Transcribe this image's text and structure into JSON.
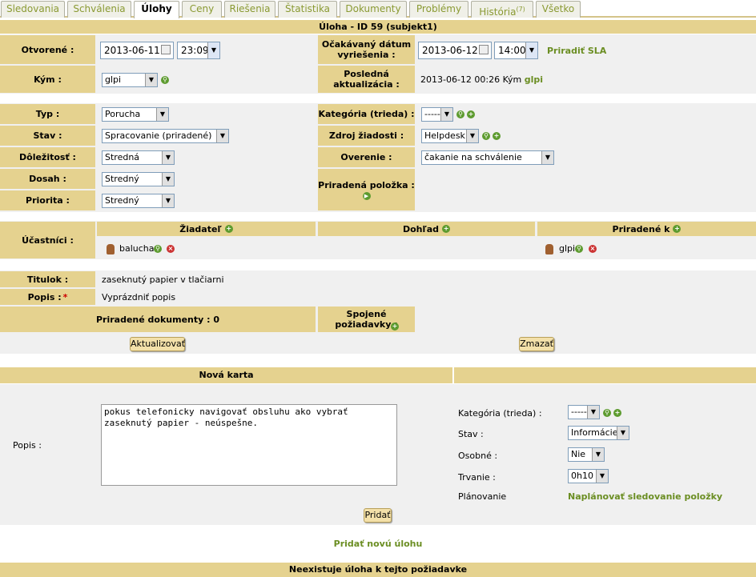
{
  "tabs": [
    "Sledovania",
    "Schválenia",
    "Úlohy",
    "Ceny",
    "Riešenia",
    "Štatistika",
    "Dokumenty",
    "Problémy",
    "História",
    "Všetko"
  ],
  "history_count": "(7)",
  "title": "Úloha - ID 59 (subjekt1)",
  "opened_label": "Otvorené :",
  "opened_date": "2013-06-11",
  "opened_time": "23:09",
  "expected_label": "Očakávaný dátum vyriešenia :",
  "expected_date": "2013-06-12",
  "expected_time": "14:00",
  "sla_link": "Priradiť SLA",
  "by_label": "Kým :",
  "by_value": "glpi",
  "last_update_label": "Posledná aktualizácia :",
  "last_update_text": "2013-06-12 00:26 Kým",
  "last_update_user": "glpi",
  "type_label": "Typ :",
  "type_value": "Porucha",
  "status_label": "Stav :",
  "status_value": "Spracovanie (priradené)",
  "urgency_label": "Dôležitosť :",
  "urgency_value": "Stredná",
  "impact_label": "Dosah :",
  "impact_value": "Stredný",
  "priority_label": "Priorita :",
  "priority_value": "Stredný",
  "category_label": "Kategória (trieda) :",
  "category_value": "-----",
  "source_label": "Zdroj žiadosti :",
  "source_value": "Helpdesk",
  "validation_label": "Overenie :",
  "validation_value": "čakanie na schválenie",
  "item_label": "Priradená položka :",
  "actors_label": "Účastníci :",
  "requester_header": "Žiadateľ",
  "observer_header": "Dohľad",
  "assigned_header": "Priradené k",
  "requester_name": "balucha",
  "assigned_name": "glpi",
  "title_label": "Titulok :",
  "title_value": "zaseknutý papier v tlačiarni",
  "desc_label": "Popis :",
  "desc_required": "*",
  "desc_value": "Vyprázdniť popis",
  "docs_label": "Priradené dokumenty : 0",
  "linked_label": "Spojené požiadavky :",
  "update_button": "Aktualizovať",
  "delete_button": "Zmazať",
  "new_card_header": "Nová karta",
  "nc_desc_label": "Popis :",
  "nc_desc_value": "pokus telefonicky navigovať obsluhu ako vybrať zaseknutý papier - neúspešne.",
  "nc_category_label": "Kategória (trieda) :",
  "nc_category_value": "-----",
  "nc_status_label": "Stav :",
  "nc_status_value": "Informácie",
  "nc_private_label": "Osobné :",
  "nc_private_value": "Nie",
  "nc_duration_label": "Trvanie :",
  "nc_duration_value": "0h10",
  "nc_planning_label": "Plánovanie",
  "nc_planning_link": "Naplánovať sledovanie položky",
  "add_button": "Pridať",
  "new_task_link": "Pridať novú úlohu",
  "no_task_text": "Neexistuje úloha k tejto požiadavke"
}
